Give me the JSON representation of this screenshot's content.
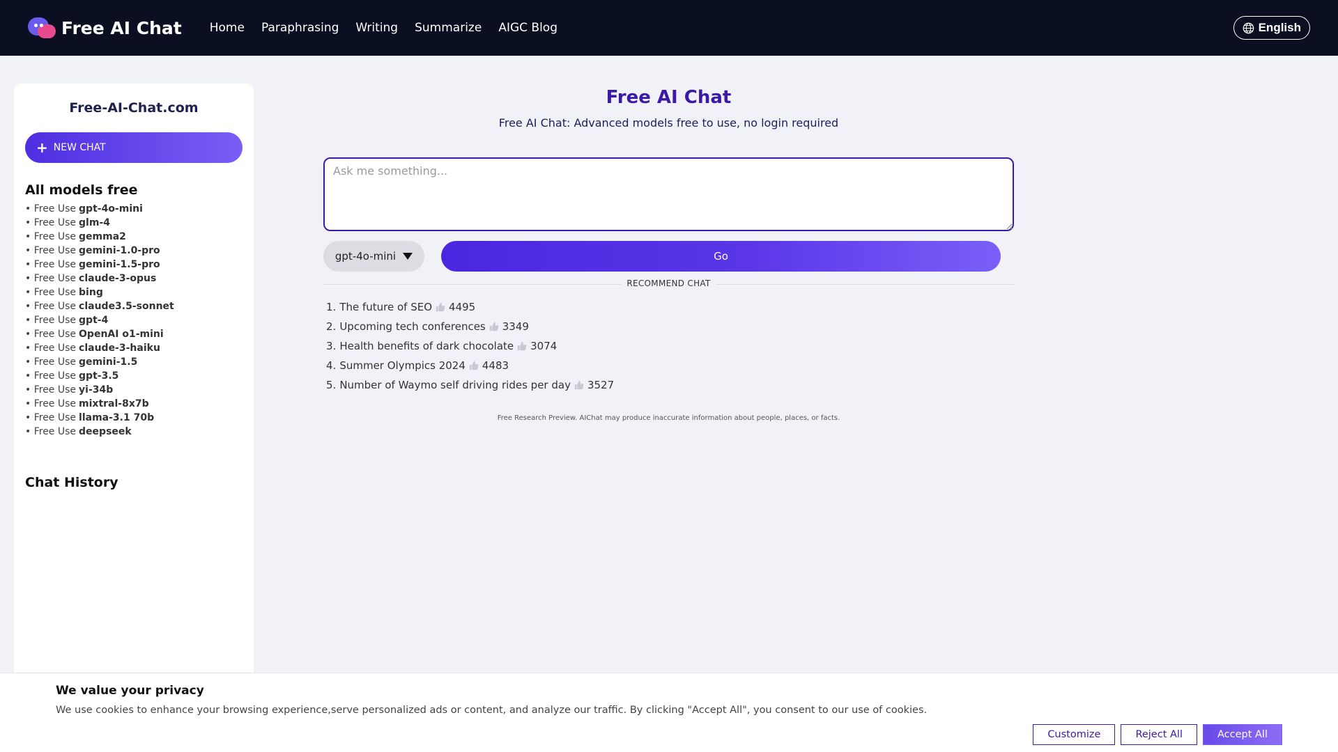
{
  "header": {
    "logo_text": "Free AI Chat",
    "nav": [
      "Home",
      "Paraphrasing",
      "Writing",
      "Summarize",
      "AIGC Blog"
    ],
    "language": "English"
  },
  "sidebar": {
    "site_name": "Free-AI-Chat.com",
    "new_chat_label": "NEW CHAT",
    "models_title": "All models free",
    "model_prefix": "• Free Use",
    "models": [
      "gpt-4o-mini",
      "glm-4",
      "gemma2",
      "gemini-1.0-pro",
      "gemini-1.5-pro",
      "claude-3-opus",
      "bing",
      "claude3.5-sonnet",
      "gpt-4",
      "OpenAI o1-mini",
      "claude-3-haiku",
      "gemini-1.5",
      "gpt-3.5",
      "yi-34b",
      "mixtral-8x7b",
      "llama-3.1 70b",
      "deepseek"
    ],
    "history_title": "Chat History"
  },
  "main": {
    "title": "Free AI Chat",
    "subtitle": "Free AI Chat: Advanced models free to use, no login required",
    "input_placeholder": "Ask me something...",
    "selected_model": "gpt-4o-mini",
    "go_label": "Go",
    "recommend_label": "RECOMMEND CHAT",
    "recommendations": [
      {
        "index": "1.",
        "text": "The future of SEO",
        "likes": "4495"
      },
      {
        "index": "2.",
        "text": "Upcoming tech conferences",
        "likes": "3349"
      },
      {
        "index": "3.",
        "text": "Health benefits of dark chocolate",
        "likes": "3074"
      },
      {
        "index": "4.",
        "text": "Summer Olympics 2024",
        "likes": "4483"
      },
      {
        "index": "5.",
        "text": "Number of Waymo self driving rides per day",
        "likes": "3527"
      }
    ],
    "disclaimer": "Free Research Preview. AIChat may produce inaccurate information about people, places, or facts."
  },
  "cookie": {
    "title": "We value your privacy",
    "text": "We use cookies to enhance your browsing experience,serve personalized ads or content, and analyze our traffic. By clicking \"Accept All\", you consent to our use of cookies.",
    "customize_label": "Customize",
    "reject_label": "Reject All",
    "accept_label": "Accept All"
  },
  "colors": {
    "header_bg": "#0a0f22",
    "accent": "#3b1aa8",
    "button_gradient_start": "#4a26e0",
    "button_gradient_end": "#7b5ef8",
    "page_bg": "#f0f2f8"
  },
  "icons": {
    "logo": "chat-bubbles-icon",
    "language": "globe-icon",
    "new_chat": "plus-icon",
    "model_select": "caret-down-icon",
    "recommendation_like": "thumbs-up-icon"
  }
}
